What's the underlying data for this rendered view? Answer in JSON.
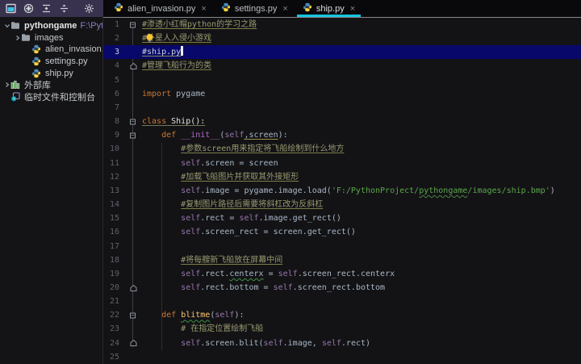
{
  "ui": {
    "close_glyph": "×",
    "accent_cyan": "#14c4de",
    "caret_row_color": "#08086b",
    "toolbar_bg": "#38324e",
    "editor_bg": "#131316"
  },
  "panel_toolbar": {
    "icons": [
      "project-window-icon",
      "locate-file-icon",
      "collapse-all-icon",
      "expand-all-icon",
      "settings-gear-icon",
      "hide-panel-icon"
    ]
  },
  "project_panel": {
    "tree": [
      {
        "label": "pythongame",
        "suffix": "F:\\Pyth",
        "icon": "folder-icon",
        "chevron": "down",
        "level": 0,
        "bold": true
      },
      {
        "label": "images",
        "icon": "folder-icon",
        "chevron": "right",
        "level": 1
      },
      {
        "label": "alien_invasion.py",
        "icon": "python-file-icon",
        "chevron": null,
        "level": 2
      },
      {
        "label": "settings.py",
        "icon": "python-file-icon",
        "chevron": null,
        "level": 2
      },
      {
        "label": "ship.py",
        "icon": "python-file-icon",
        "chevron": null,
        "level": 2
      },
      {
        "label": "外部库",
        "icon": "library-icon",
        "chevron": "right",
        "level": 0
      },
      {
        "label": "临时文件和控制台",
        "icon": "scratch-icon",
        "chevron": null,
        "level": 0
      }
    ]
  },
  "tabs": [
    {
      "label": "alien_invasion.py",
      "icon": "python-file-icon",
      "active": false
    },
    {
      "label": "settings.py",
      "icon": "python-file-icon",
      "active": false
    },
    {
      "label": "ship.py",
      "icon": "python-file-icon",
      "active": true
    }
  ],
  "editor": {
    "lines": [
      {
        "n": 1,
        "fold": "start",
        "tokens": [
          [
            "comu",
            "#渗透小红帽python的学习之路"
          ]
        ]
      },
      {
        "n": 2,
        "fold": null,
        "bulb": true,
        "tokens": [
          [
            "comu",
            "#外星人入侵小游戏"
          ]
        ]
      },
      {
        "n": 3,
        "fold": null,
        "caret": true,
        "cursor": true,
        "tokens": [
          [
            "caret",
            "#ship.py"
          ]
        ]
      },
      {
        "n": 4,
        "fold": "end",
        "tokens": [
          [
            "comu",
            "#管理飞船行为的类"
          ]
        ]
      },
      {
        "n": 5,
        "fold": null,
        "tokens": []
      },
      {
        "n": 6,
        "fold": null,
        "tokens": [
          [
            "kw",
            "import"
          ],
          [
            "pl",
            " pygame"
          ]
        ]
      },
      {
        "n": 7,
        "fold": null,
        "tokens": []
      },
      {
        "n": 8,
        "fold": "start",
        "tokens": [
          [
            "kwu",
            "class"
          ],
          [
            "clsu",
            " Ship():"
          ]
        ]
      },
      {
        "n": 9,
        "fold": "start",
        "tokens": [
          [
            "pl",
            "    "
          ],
          [
            "kw",
            "def "
          ],
          [
            "magic",
            "__init__"
          ],
          [
            "pl",
            "("
          ],
          [
            "self",
            "self"
          ],
          [
            "warnu",
            ",screen"
          ],
          [
            "pl",
            "):"
          ]
        ]
      },
      {
        "n": 10,
        "fold": null,
        "tokens": [
          [
            "pl",
            "        "
          ],
          [
            "comu",
            "#参数screen用来指定将飞船绘制到什么地方"
          ]
        ]
      },
      {
        "n": 11,
        "fold": null,
        "tokens": [
          [
            "pl",
            "        "
          ],
          [
            "self",
            "self"
          ],
          [
            "pl",
            ".screen = screen"
          ]
        ]
      },
      {
        "n": 12,
        "fold": null,
        "tokens": [
          [
            "pl",
            "        "
          ],
          [
            "comu",
            "#加载飞船图片并获取其外接矩形"
          ]
        ]
      },
      {
        "n": 13,
        "fold": null,
        "tokens": [
          [
            "pl",
            "        "
          ],
          [
            "self",
            "self"
          ],
          [
            "pl",
            ".image = pygame.image.load("
          ],
          [
            "str",
            "'F:/PythonProject/"
          ],
          [
            "stru",
            "pythongame"
          ],
          [
            "str",
            "/images/ship.bmp'"
          ],
          [
            "pl",
            ")"
          ]
        ]
      },
      {
        "n": 14,
        "fold": null,
        "tokens": [
          [
            "pl",
            "        "
          ],
          [
            "comu",
            "#复制图片路径后需要将斜杠改为反斜杠"
          ]
        ]
      },
      {
        "n": 15,
        "fold": null,
        "tokens": [
          [
            "pl",
            "        "
          ],
          [
            "self",
            "self"
          ],
          [
            "pl",
            ".rect = "
          ],
          [
            "self",
            "self"
          ],
          [
            "pl",
            ".image.get_rect()"
          ]
        ]
      },
      {
        "n": 16,
        "fold": null,
        "tokens": [
          [
            "pl",
            "        "
          ],
          [
            "self",
            "self"
          ],
          [
            "pl",
            ".screen_rect = screen.get_rect()"
          ]
        ]
      },
      {
        "n": 17,
        "fold": null,
        "tokens": []
      },
      {
        "n": 18,
        "fold": null,
        "tokens": [
          [
            "pl",
            "        "
          ],
          [
            "comu",
            "#将每艘新飞船放在屏幕中间"
          ]
        ]
      },
      {
        "n": 19,
        "fold": null,
        "tokens": [
          [
            "pl",
            "        "
          ],
          [
            "self",
            "self"
          ],
          [
            "pl",
            ".rect."
          ],
          [
            "typo",
            "centerx"
          ],
          [
            "pl",
            " = "
          ],
          [
            "self",
            "self"
          ],
          [
            "pl",
            ".screen_rect.centerx"
          ]
        ]
      },
      {
        "n": 20,
        "fold": "end",
        "tokens": [
          [
            "pl",
            "        "
          ],
          [
            "self",
            "self"
          ],
          [
            "pl",
            ".rect.bottom = "
          ],
          [
            "self",
            "self"
          ],
          [
            "pl",
            ".screen_rect.bottom"
          ]
        ]
      },
      {
        "n": 21,
        "fold": null,
        "tokens": []
      },
      {
        "n": 22,
        "fold": "start",
        "tokens": [
          [
            "pl",
            "    "
          ],
          [
            "kw",
            "def "
          ],
          [
            "fnu",
            "blitme"
          ],
          [
            "pl",
            "("
          ],
          [
            "self",
            "self"
          ],
          [
            "pl",
            "):"
          ]
        ]
      },
      {
        "n": 23,
        "fold": null,
        "tokens": [
          [
            "pl",
            "        "
          ],
          [
            "com",
            "# 在指定位置绘制飞船"
          ]
        ]
      },
      {
        "n": 24,
        "fold": "end",
        "tokens": [
          [
            "pl",
            "        "
          ],
          [
            "self",
            "self"
          ],
          [
            "pl",
            ".screen.blit("
          ],
          [
            "self",
            "self"
          ],
          [
            "pl",
            ".image, "
          ],
          [
            "self",
            "self"
          ],
          [
            "pl",
            ".rect)"
          ]
        ]
      },
      {
        "n": 25,
        "fold": null,
        "tokens": []
      }
    ]
  }
}
